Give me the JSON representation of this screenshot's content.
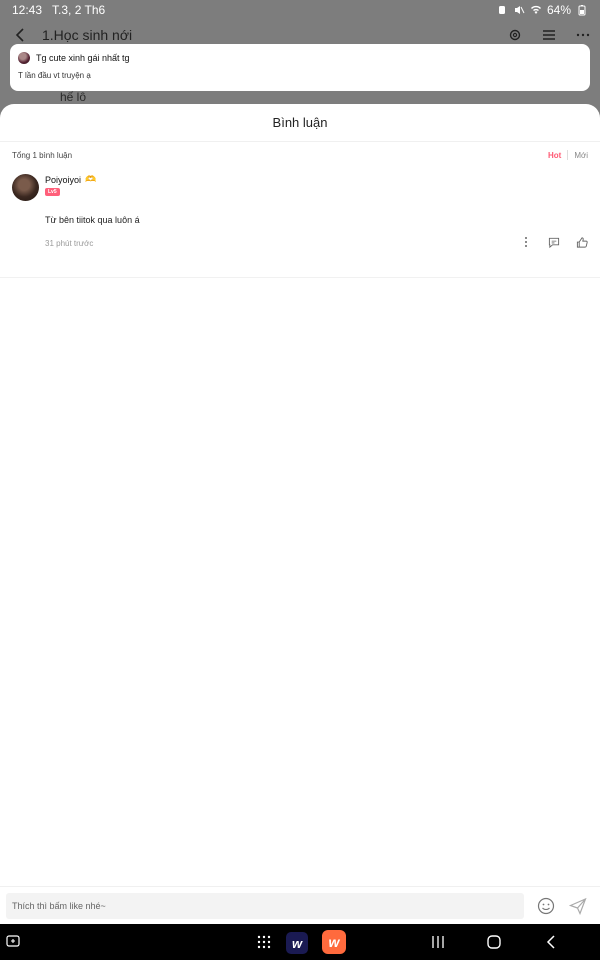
{
  "status": {
    "time": "12:43",
    "date": "T.3, 2 Th6",
    "battery": "64%"
  },
  "reader": {
    "chapter_title": "1.Học sinh nới",
    "behind_text": "hế lô"
  },
  "notification": {
    "sender": "Tg cute xinh gái nhất tg",
    "message": "T lần đầu vt truyện ạ"
  },
  "sheet": {
    "title": "Bình luận",
    "total": "Tổng 1 bình luận",
    "sort_hot": "Hot",
    "sort_new": "Mới"
  },
  "comments": [
    {
      "username": "Poiyoiyoi",
      "emoji": "🫶",
      "level": "Lv5",
      "text": "Từ bên tiitok qua luôn á",
      "time": "31 phút trước"
    }
  ],
  "input": {
    "placeholder": "Thích thì bấm like nhé~"
  },
  "navbar": {
    "app1_letter": "w",
    "app2_letter": "w"
  },
  "colors": {
    "accent": "#ff5a74",
    "overlay": "#7d7d7d"
  }
}
